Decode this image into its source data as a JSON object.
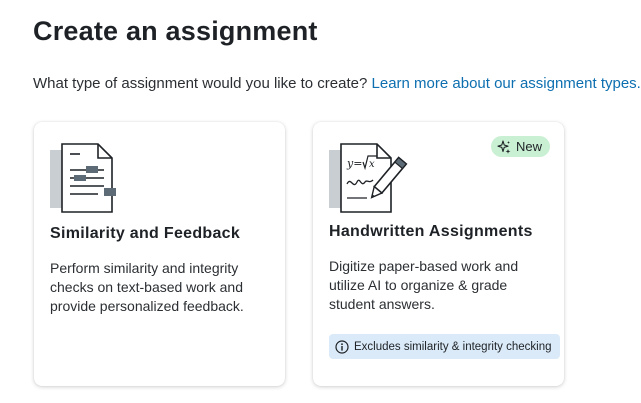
{
  "page": {
    "title": "Create an assignment",
    "prompt": "What type of assignment would you like to create?",
    "learn_more_link": "Learn more about our assignment types."
  },
  "cards": [
    {
      "title": "Similarity and Feedback",
      "description": "Perform similarity and integrity checks on text-based work and provide personalized feedback.",
      "icon": "document-similarity-icon"
    },
    {
      "title": "Handwritten Assignments",
      "description": "Digitize paper-based work and utilize AI to organize & grade student answers.",
      "icon": "handwritten-document-icon",
      "badge": "New",
      "badge_icon": "sparkle-icon",
      "note": "Excludes similarity & integrity checking",
      "note_icon": "info-icon"
    }
  ],
  "colors": {
    "link": "#0d6fb0",
    "badge_bg": "#c9f0d3",
    "note_bg": "#dbeaf8",
    "illustration_accent": "#5c6b75"
  }
}
